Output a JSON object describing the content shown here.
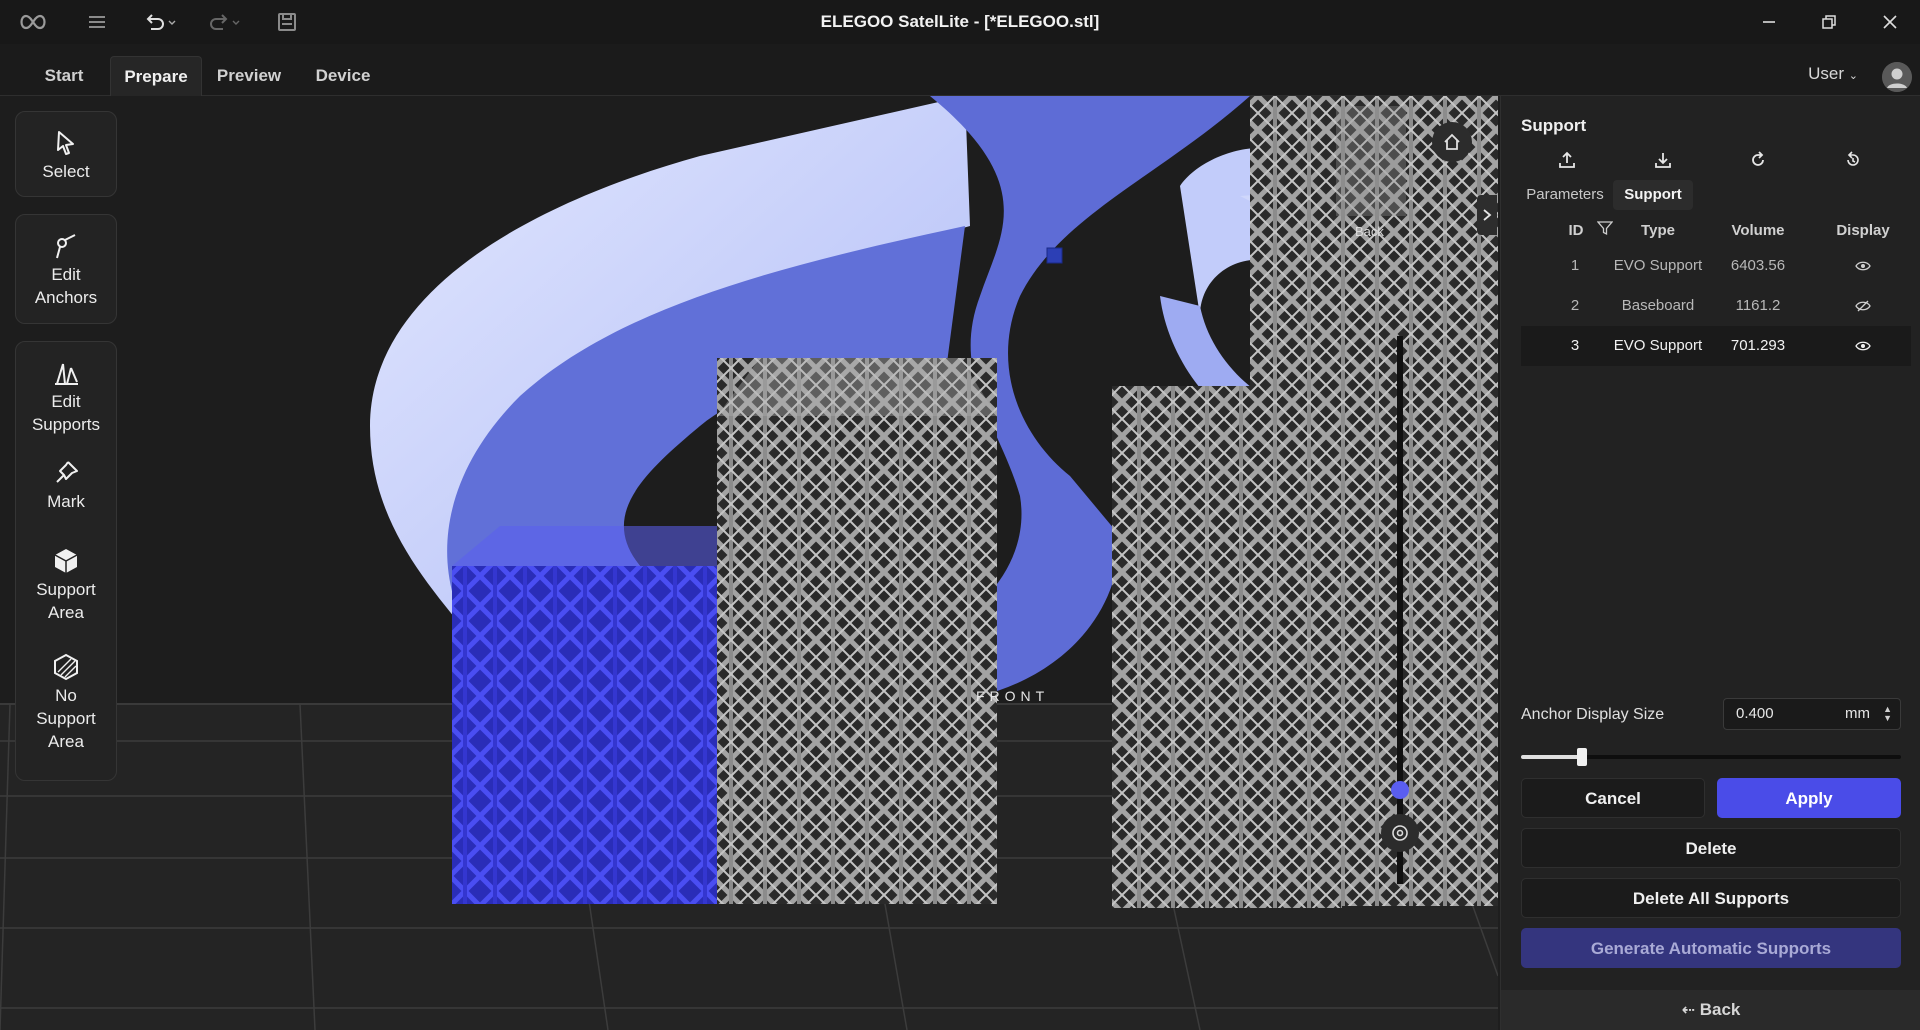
{
  "window": {
    "title": "ELEGOO SatelLite - [*ELEGOO.stl]"
  },
  "tabs": [
    {
      "label": "Start"
    },
    {
      "label": "Prepare"
    },
    {
      "label": "Preview"
    },
    {
      "label": "Device"
    }
  ],
  "user": {
    "label": "User"
  },
  "toolbar": {
    "select": "Select",
    "edit_anchors": "Edit Anchors",
    "edit_supports": "Edit Supports",
    "mark": "Mark",
    "support_area": "Support Area",
    "no_support_area": "No Support Area"
  },
  "viewport": {
    "view_cube_label": "Back",
    "front_label": "FRONT"
  },
  "panel": {
    "title": "Support",
    "subtabs": [
      "Parameters",
      "Support"
    ],
    "active_subtab": "Support",
    "table": {
      "columns": [
        "ID",
        "Type",
        "Volume",
        "Display"
      ],
      "rows": [
        {
          "id": "1",
          "type": "EVO Support",
          "volume": "6403.56",
          "display": "visible"
        },
        {
          "id": "2",
          "type": "Baseboard",
          "volume": "1161.2",
          "display": "hidden"
        },
        {
          "id": "3",
          "type": "EVO Support",
          "volume": "701.293",
          "display": "visible",
          "selected": true
        }
      ]
    },
    "anchor_display_size": {
      "label": "Anchor Display Size",
      "value": "0.400",
      "unit": "mm",
      "slider_fraction": 0.16
    },
    "buttons": {
      "cancel": "Cancel",
      "apply": "Apply",
      "delete": "Delete",
      "delete_all": "Delete All Supports",
      "generate": "Generate Automatic Supports",
      "back": "Back"
    }
  },
  "colors": {
    "accent": "#4a4ce8",
    "model_light": "#c7d0fa",
    "model_dark": "#5e6fd8",
    "support_selected": "#3c3fe0",
    "support_gray": "#9a9a9a"
  }
}
